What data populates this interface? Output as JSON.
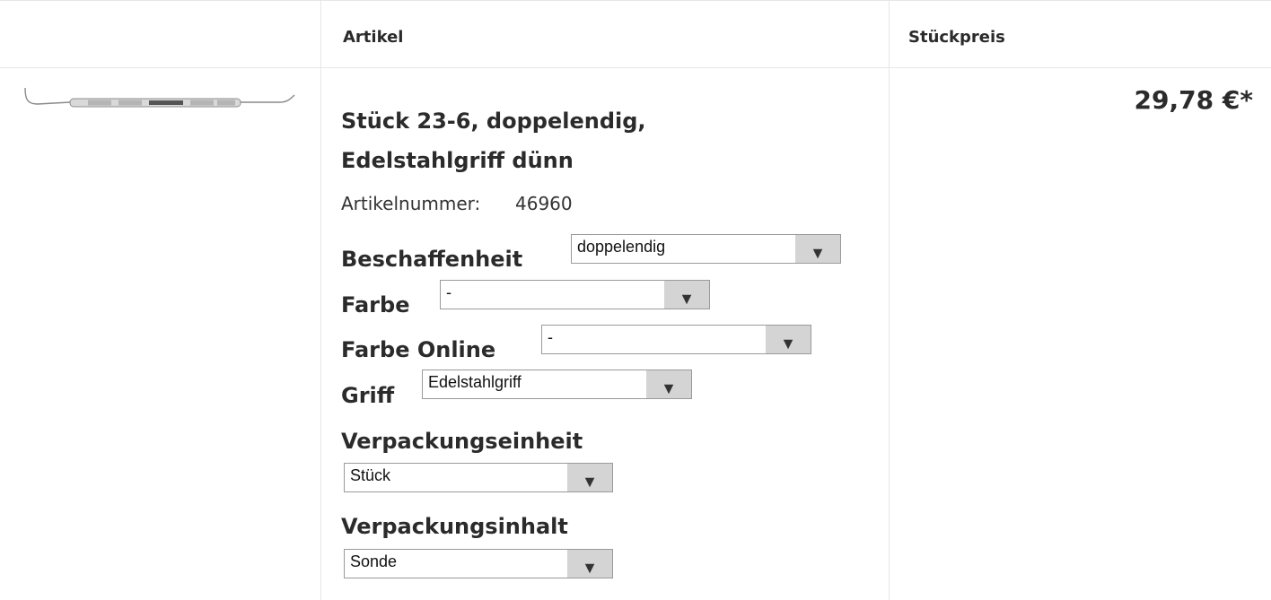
{
  "table": {
    "headers": {
      "article": "Artikel",
      "unit_price": "Stückpreis"
    }
  },
  "product": {
    "title_line1": "Stück 23-6, doppelendig,",
    "title_line2": "Edelstahlgriff dünn",
    "article_number_label": "Artikelnummer:",
    "article_number": "46960",
    "price": "29,78 €*",
    "image_icon": "dental-probe-instrument"
  },
  "options": {
    "beschaffenheit": {
      "label": "Beschaffenheit",
      "value": "doppelendig"
    },
    "farbe": {
      "label": "Farbe",
      "value": "-"
    },
    "farbe_online": {
      "label": "Farbe Online",
      "value": "-"
    },
    "griff": {
      "label": "Griff",
      "value": "Edelstahlgriff"
    },
    "verpackungseinheit": {
      "label": "Verpackungseinheit",
      "value": "Stück"
    },
    "verpackungsinhalt": {
      "label": "Verpackungsinhalt",
      "value": "Sonde"
    }
  },
  "icons": {
    "dropdown_arrow": "▼"
  }
}
